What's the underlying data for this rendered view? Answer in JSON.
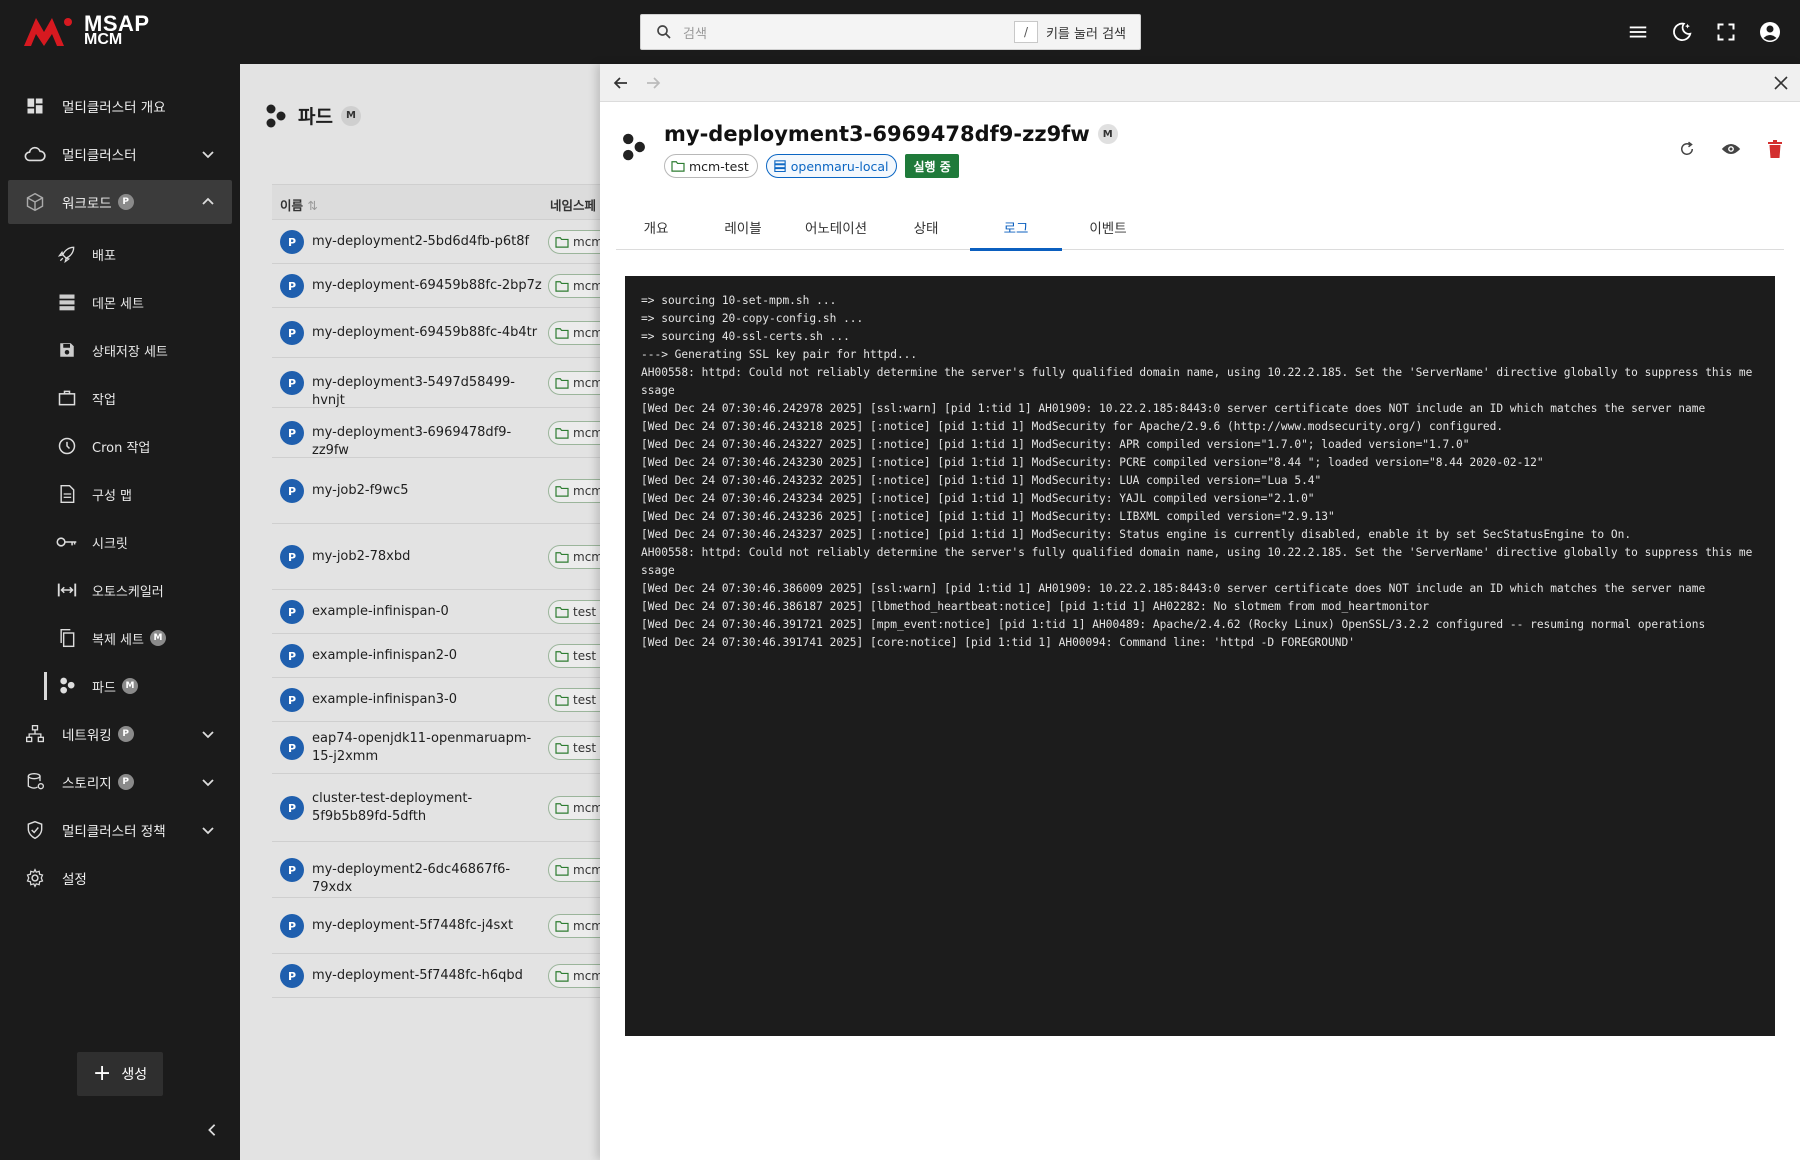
{
  "app": {
    "logo_line1": "MSAP",
    "logo_line2": "MCM",
    "brand_color": "#d71920"
  },
  "search": {
    "placeholder": "검색",
    "shortcut_key": "/",
    "hint": "키를 눌러 검색"
  },
  "top_icons": [
    "menu-icon",
    "dark-mode-icon",
    "fullscreen-icon",
    "account-icon"
  ],
  "sidebar": {
    "items": [
      {
        "label": "멀티클러스터 개요",
        "icon": "dashboard-icon"
      },
      {
        "label": "멀티클러스터",
        "icon": "cloud-icon"
      },
      {
        "label": "워크로드",
        "icon": "cube-icon",
        "badge": "P"
      },
      {
        "label": "네트워킹",
        "icon": "network-icon",
        "badge": "P"
      },
      {
        "label": "스토리지",
        "icon": "storage-icon",
        "badge": "P"
      },
      {
        "label": "멀티클러스터 정책",
        "icon": "shield-icon"
      },
      {
        "label": "설정",
        "icon": "gear-icon"
      }
    ],
    "sub_items": [
      {
        "label": "배포",
        "icon": "rocket-icon"
      },
      {
        "label": "데몬 세트",
        "icon": "server-stack-icon"
      },
      {
        "label": "상태저장 세트",
        "icon": "save-icon"
      },
      {
        "label": "작업",
        "icon": "briefcase-icon"
      },
      {
        "label": "Cron 작업",
        "icon": "clock-icon"
      },
      {
        "label": "구성 맵",
        "icon": "document-icon"
      },
      {
        "label": "시크릿",
        "icon": "key-icon"
      },
      {
        "label": "오토스케일러",
        "icon": "scale-horizontal-icon"
      },
      {
        "label": "복제 세트",
        "icon": "copy-icon",
        "badge": "M"
      },
      {
        "label": "파드",
        "icon": "pods-icon",
        "badge": "M"
      }
    ],
    "create_label": "생성"
  },
  "list": {
    "title": "파드",
    "title_badge": "M",
    "col_name": "이름",
    "col_namespace": "네임스페",
    "rows": [
      {
        "badge": "P",
        "name": "my-deployment2-5bd6d4fb-p6t8f",
        "ns": "mcm"
      },
      {
        "badge": "P",
        "name": "my-deployment-69459b88fc-2bp7z",
        "ns": "mcm"
      },
      {
        "badge": "P",
        "name": "my-deployment-69459b88fc-4b4tr",
        "ns": "mcm"
      },
      {
        "badge": "P",
        "name": "my-deployment3-5497d58499-hvnjt",
        "ns": "mcm"
      },
      {
        "badge": "P",
        "name": "my-deployment3-6969478df9-zz9fw",
        "ns": "mcm"
      },
      {
        "badge": "P",
        "name": "my-job2-f9wc5",
        "ns": "mcm"
      },
      {
        "badge": "P",
        "name": "my-job2-78xbd",
        "ns": "mcm"
      },
      {
        "badge": "P",
        "name": "example-infinispan-0",
        "ns": "test"
      },
      {
        "badge": "P",
        "name": "example-infinispan2-0",
        "ns": "test"
      },
      {
        "badge": "P",
        "name": "example-infinispan3-0",
        "ns": "test"
      },
      {
        "badge": "P",
        "name": "eap74-openjdk11-openmaruapm-15-j2xmm",
        "ns": "test"
      },
      {
        "badge": "P",
        "name": "cluster-test-deployment-5f9b5b89fd-5dfth",
        "ns": "mcm"
      },
      {
        "badge": "P",
        "name": "my-deployment2-6dc46867f6-79xdx",
        "ns": "mcm"
      },
      {
        "badge": "P",
        "name": "my-deployment-5f7448fc-j4sxt",
        "ns": "mcm"
      },
      {
        "badge": "P",
        "name": "my-deployment-5f7448fc-h6qbd",
        "ns": "mcm"
      }
    ]
  },
  "drawer": {
    "title": "my-deployment3-6969478df9-zz9fw",
    "title_badge": "M",
    "namespace_chip": "mcm-test",
    "cluster_chip": "openmaru-local",
    "status": "실행 중",
    "status_color": "#1f7a3a",
    "tabs": [
      "개요",
      "레이블",
      "어노테이션",
      "상태",
      "로그",
      "이벤트"
    ],
    "active_tab": "로그",
    "log_lines": [
      "=> sourcing 10-set-mpm.sh ...",
      "=> sourcing 20-copy-config.sh ...",
      "=> sourcing 40-ssl-certs.sh ...",
      "---> Generating SSL key pair for httpd...",
      "AH00558: httpd: Could not reliably determine the server's fully qualified domain name, using 10.22.2.185. Set the 'ServerName' directive globally to suppress this message",
      "[Wed Dec 24 07:30:46.242978 2025] [ssl:warn] [pid 1:tid 1] AH01909: 10.22.2.185:8443:0 server certificate does NOT include an ID which matches the server name",
      "[Wed Dec 24 07:30:46.243218 2025] [:notice] [pid 1:tid 1] ModSecurity for Apache/2.9.6 (http://www.modsecurity.org/) configured.",
      "[Wed Dec 24 07:30:46.243227 2025] [:notice] [pid 1:tid 1] ModSecurity: APR compiled version=\"1.7.0\"; loaded version=\"1.7.0\"",
      "[Wed Dec 24 07:30:46.243230 2025] [:notice] [pid 1:tid 1] ModSecurity: PCRE compiled version=\"8.44 \"; loaded version=\"8.44 2020-02-12\"",
      "[Wed Dec 24 07:30:46.243232 2025] [:notice] [pid 1:tid 1] ModSecurity: LUA compiled version=\"Lua 5.4\"",
      "[Wed Dec 24 07:30:46.243234 2025] [:notice] [pid 1:tid 1] ModSecurity: YAJL compiled version=\"2.1.0\"",
      "[Wed Dec 24 07:30:46.243236 2025] [:notice] [pid 1:tid 1] ModSecurity: LIBXML compiled version=\"2.9.13\"",
      "[Wed Dec 24 07:30:46.243237 2025] [:notice] [pid 1:tid 1] ModSecurity: Status engine is currently disabled, enable it by set SecStatusEngine to On.",
      "AH00558: httpd: Could not reliably determine the server's fully qualified domain name, using 10.22.2.185. Set the 'ServerName' directive globally to suppress this message",
      "[Wed Dec 24 07:30:46.386009 2025] [ssl:warn] [pid 1:tid 1] AH01909: 10.22.2.185:8443:0 server certificate does NOT include an ID which matches the server name",
      "[Wed Dec 24 07:30:46.386187 2025] [lbmethod_heartbeat:notice] [pid 1:tid 1] AH02282: No slotmem from mod_heartmonitor",
      "[Wed Dec 24 07:30:46.391721 2025] [mpm_event:notice] [pid 1:tid 1] AH00489: Apache/2.4.62 (Rocky Linux) OpenSSL/3.2.2 configured -- resuming normal operations",
      "[Wed Dec 24 07:30:46.391741 2025] [core:notice] [pid 1:tid 1] AH00094: Command line: 'httpd -D FOREGROUND'"
    ]
  }
}
